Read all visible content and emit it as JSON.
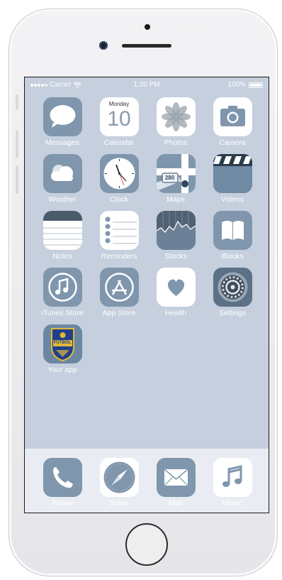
{
  "status_bar": {
    "carrier": "Carrier",
    "time": "1:20 PM",
    "battery": "100%"
  },
  "apps": [
    {
      "label": "Messages",
      "icon": "messages-icon"
    },
    {
      "label": "Calendar",
      "icon": "calendar-icon",
      "weekday": "Monday",
      "day": "10"
    },
    {
      "label": "Photos",
      "icon": "photos-icon"
    },
    {
      "label": "Camera",
      "icon": "camera-icon"
    },
    {
      "label": "Weather",
      "icon": "weather-icon"
    },
    {
      "label": "Clock",
      "icon": "clock-icon"
    },
    {
      "label": "Maps",
      "icon": "maps-icon",
      "road_sign": "280"
    },
    {
      "label": "Videos",
      "icon": "videos-icon"
    },
    {
      "label": "Notes",
      "icon": "notes-icon"
    },
    {
      "label": "Reminders",
      "icon": "reminders-icon"
    },
    {
      "label": "Stocks",
      "icon": "stocks-icon"
    },
    {
      "label": "iBooks",
      "icon": "ibooks-icon"
    },
    {
      "label": "iTunes Store",
      "icon": "itunes-icon"
    },
    {
      "label": "App Store",
      "icon": "app-store-icon"
    },
    {
      "label": "Health",
      "icon": "health-icon"
    },
    {
      "label": "Settings",
      "icon": "settings-icon"
    },
    {
      "label": "Your app",
      "icon": "your-app-icon",
      "badge_text": "FUTBOL"
    }
  ],
  "dock": [
    {
      "label": "Phone",
      "icon": "phone-icon"
    },
    {
      "label": "Safari",
      "icon": "safari-icon"
    },
    {
      "label": "Mail",
      "icon": "mail-icon"
    },
    {
      "label": "Music",
      "icon": "music-icon"
    }
  ],
  "colors": {
    "wallpaper": "#c5cfdd",
    "icon_blue_gray": "#7f96ad",
    "dock": "#e9edf3"
  }
}
